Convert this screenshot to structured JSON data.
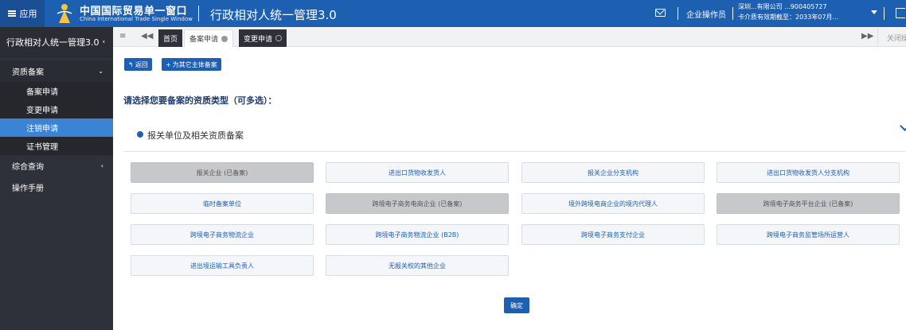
{
  "topbar": {
    "apps_label": "应用",
    "brand_cn": "中国国际贸易单一窗口",
    "brand_en": "China International Trade Single Window",
    "system_title": "行政相对人统一管理3.0",
    "role": "企业操作员",
    "account_line1": "深圳...有限公司 ...900405727",
    "account_line2": "卡介质有效期截至：2033年07月..."
  },
  "sidebar": {
    "header": "行政相对人统一管理3.0",
    "groups": [
      {
        "label": "资质备案",
        "items": [
          "备案申请",
          "变更申请",
          "注销申请",
          "证书管理"
        ]
      },
      {
        "label": "综合查询"
      },
      {
        "label": "操作手册"
      }
    ]
  },
  "tabs": {
    "home": "首页",
    "tab1": "备案申请",
    "tab2": "变更申请",
    "close_ops": "关闭操作"
  },
  "main": {
    "back_btn": "返回",
    "other_btn": "为其它主体备案",
    "prompt": "请选择您要备案的资质类型（可多选）：",
    "section_title": "报关单位及相关资质备案",
    "options": [
      "报关企业 (已备案)",
      "进出口货物收发货人",
      "报关企业分支机构",
      "进出口货物收发货人分支机构",
      "临时备案单位",
      "跨境电子商务电商企业 (已备案)",
      "境外跨境电商企业的境内代理人",
      "跨境电子商务平台企业 (已备案)",
      "跨境电子商务物流企业",
      "跨境电子商务物流企业 (B2B)",
      "跨境电子商务支付企业",
      "跨境电子商务监管场所运营人",
      "进出境运输工具负责人",
      "无报关权的其他企业"
    ],
    "confirm": "确定"
  }
}
